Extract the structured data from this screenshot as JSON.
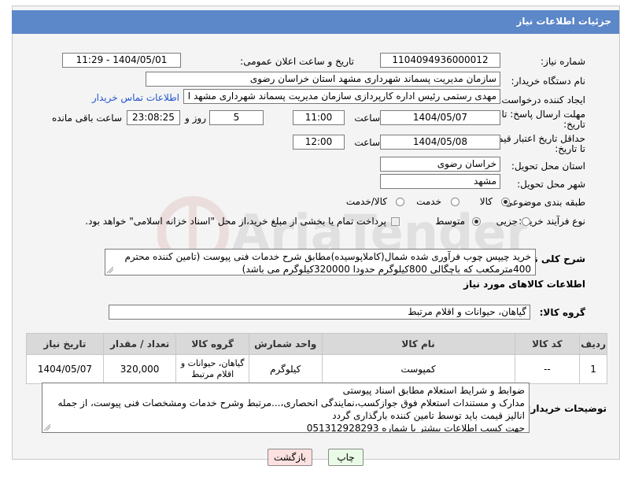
{
  "header": {
    "title": "جزئیات اطلاعات نیاز"
  },
  "need_number": {
    "label": "شماره نیاز:",
    "value": "1104094936000012"
  },
  "announce": {
    "label": "تاریخ و ساعت اعلان عمومی:",
    "value": "1404/05/01 - 11:29"
  },
  "buyer_org": {
    "label": "نام دستگاه خریدار:",
    "value": "سازمان مدیریت پسماند شهرداری مشهد استان خراسان رضوی"
  },
  "requester": {
    "label": "ایجاد کننده درخواست:",
    "value": "مهدی رستمی رئیس اداره کارپردازی سازمان مدیریت پسماند شهرداری مشهد ا",
    "contact_link": "اطلاعات تماس خریدار"
  },
  "reply_deadline": {
    "label1": "مهلت ارسال پاسخ: تا",
    "label2": "تاریخ:",
    "date": "1404/05/07",
    "time_label": "ساعت",
    "time": "11:00",
    "days": "5",
    "days_label": "روز و",
    "remaining": "23:08:25",
    "remaining_label": "ساعت باقی مانده"
  },
  "price_validity": {
    "label1": "حداقل تاریخ اعتبار قیمت:",
    "label2": "تا تاریخ:",
    "date": "1404/05/08",
    "time_label": "ساعت",
    "time": "12:00"
  },
  "delivery_province": {
    "label": "استان محل تحویل:",
    "value": "خراسان رضوی"
  },
  "delivery_city": {
    "label": "شهر محل تحویل:",
    "value": "مشهد"
  },
  "category": {
    "label": "طبقه بندی موضوعی:",
    "options": [
      "کالا",
      "خدمت",
      "کالا/خدمت"
    ],
    "selected": "کالا"
  },
  "process": {
    "label": "نوع فرآیند خرید :",
    "options": [
      "جزیی",
      "متوسط"
    ],
    "selected": "متوسط",
    "note": "پرداخت تمام یا بخشی از مبلغ خرید،از محل \"اسناد خزانه اسلامی\" خواهد بود."
  },
  "general_desc": {
    "label": "شرح کلی نیاز:",
    "line1": "خرید چیپس چوب فرآوری شده شمال(کاملاپوسیده)مطابق شرح خدمات فنی پیوست  (تامین کننده محترم",
    "line2": "400مترمکعب که باچگالی 800کیلوگرم حدودا 320000کیلوگرم می باشد)"
  },
  "goods_section": {
    "title": "اطلاعات کالاهای مورد نیاز"
  },
  "goods_group": {
    "label": "گروه کالا:",
    "value": "گیاهان، حیوانات و اقلام مرتبط"
  },
  "table": {
    "headers": [
      "ردیف",
      "کد کالا",
      "نام کالا",
      "واحد شمارش",
      "گروه کالا",
      "تعداد / مقدار",
      "تاریخ نیاز"
    ],
    "rows": [
      [
        "1",
        "--",
        "کمپوست",
        "کیلوگرم",
        "گیاهان، حیوانات و اقلام مرتبط",
        "320,000",
        "1404/05/07"
      ]
    ]
  },
  "buyer_notes": {
    "label": "توضیحات خریدار:",
    "lines": [
      "ضوابط و شرایط استعلام مطابق اسناد پیوستی",
      "مدارک و مستندات استعلام فوق جوازکسب،نمایندگی انحصاری،...مرتبط وشرح خدمات ومشخصات فنی پیوست، از جمله",
      "انالیز قیمت باید توسط تامین کننده بارگذاری گردد",
      "جهت کسب اطلاعات بیشتر با شماره 051312928293"
    ]
  },
  "buttons": {
    "print": "چاپ",
    "back": "بازگشت"
  },
  "watermark": {
    "text": "AriaTender.neT"
  },
  "colors": {
    "header_bg": "#5c87c8",
    "link": "#2255cc",
    "back_btn_bg": "#fde0e0",
    "print_btn_bg": "#e9fbe6"
  }
}
